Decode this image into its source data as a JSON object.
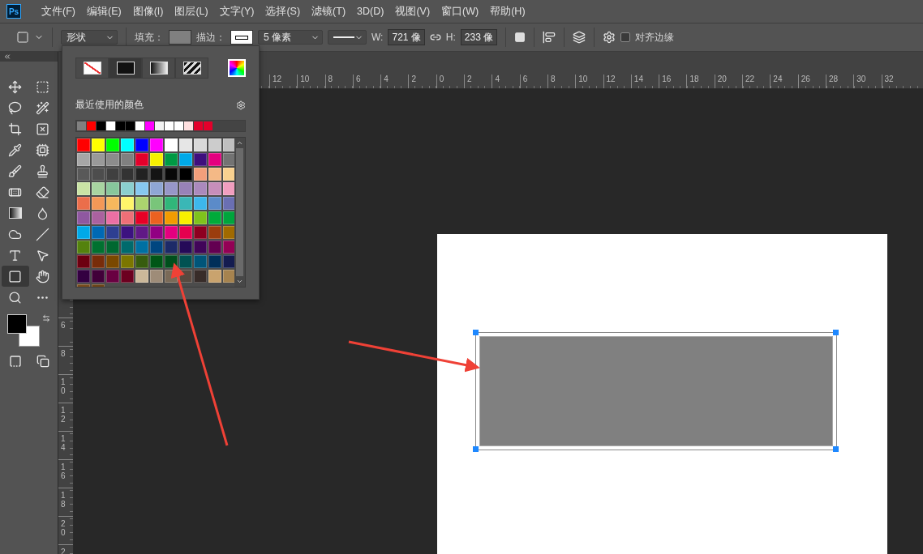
{
  "app": {
    "logo": "Ps"
  },
  "menu": [
    "文件(F)",
    "编辑(E)",
    "图像(I)",
    "图层(L)",
    "文字(Y)",
    "选择(S)",
    "滤镜(T)",
    "3D(D)",
    "视图(V)",
    "窗口(W)",
    "帮助(H)"
  ],
  "options_bar": {
    "mode": "形状",
    "fill": {
      "label": "填充：",
      "color": "#808080"
    },
    "stroke": {
      "label": "描边：",
      "color": "#ffffff"
    },
    "stroke_width": "5 像素",
    "width": {
      "label": "W:",
      "value": "721 像"
    },
    "height": {
      "label": "H:",
      "value": "233 像"
    },
    "snap": {
      "label": "对齐边缘",
      "checked": false
    }
  },
  "tools": [
    {
      "selected": false
    },
    {
      "selected": false
    },
    {
      "selected": false
    },
    {
      "selected": false
    },
    {
      "selected": false
    },
    {
      "selected": false
    },
    {
      "selected": false
    },
    {
      "selected": false
    },
    {
      "selected": false
    },
    {
      "selected": false
    },
    {
      "selected": false
    },
    {
      "selected": false
    },
    {
      "selected": false
    },
    {
      "selected": false
    },
    {
      "selected": false
    },
    {
      "selected": false
    },
    {
      "selected": false
    },
    {
      "selected": false
    },
    {
      "selected": true
    },
    {
      "selected": false
    },
    {
      "selected": false
    },
    {
      "selected": false
    }
  ],
  "colors": {
    "foreground": {
      "color": "#000000"
    },
    "background": {
      "color": "#ffffff"
    }
  },
  "swatch_panel": {
    "fill_types": [
      {
        "kind": "none",
        "selected": false
      },
      {
        "kind": "solid",
        "selected": true
      },
      {
        "kind": "gradient",
        "selected": false
      },
      {
        "kind": "pattern",
        "selected": false
      }
    ],
    "recent_title": "最近使用的颜色",
    "recent": [
      {
        "color": "#808080"
      },
      {
        "color": "#ff0000"
      },
      {
        "color": "#000000"
      },
      {
        "color": "#ffffff"
      },
      {
        "color": "#000000"
      },
      {
        "color": "#000000"
      },
      {
        "color": "#ffffff"
      },
      {
        "color": "#ff00ff"
      },
      {
        "color": "#f2f2f2"
      },
      {
        "color": "#ffffff"
      },
      {
        "color": "#ffffff"
      },
      {
        "color": "#ffe0e0"
      },
      {
        "color": "#e4002b"
      },
      {
        "color": "#e4002b"
      }
    ],
    "rows": [
      {
        "swatches": [
          {
            "color": "#ff0000"
          },
          {
            "color": "#ffff00"
          },
          {
            "color": "#00ff00"
          },
          {
            "color": "#00ffff"
          },
          {
            "color": "#0000ff"
          },
          {
            "color": "#ff00ff"
          },
          {
            "color": "#ffffff"
          },
          {
            "color": "#e6e6e6"
          },
          {
            "color": "#d9d9d9"
          },
          {
            "color": "#cccccc"
          },
          {
            "color": "#bfbfbf"
          }
        ]
      },
      {
        "swatches": [
          {
            "color": "#a6a6a6"
          },
          {
            "color": "#999999"
          },
          {
            "color": "#8c8c8c"
          },
          {
            "color": "#808080"
          },
          {
            "color": "#e4002b"
          },
          {
            "color": "#f7f000"
          },
          {
            "color": "#009a44"
          },
          {
            "color": "#00a9e8"
          },
          {
            "color": "#3e0f7d"
          },
          {
            "color": "#e4007f"
          },
          {
            "color": "#737373"
          }
        ]
      },
      {
        "swatches": [
          {
            "color": "#595959"
          },
          {
            "color": "#4d4d4d"
          },
          {
            "color": "#404040"
          },
          {
            "color": "#333333"
          },
          {
            "color": "#222222"
          },
          {
            "color": "#141414"
          },
          {
            "color": "#080808"
          },
          {
            "color": "#000000"
          },
          {
            "color": "#f29f7b"
          },
          {
            "color": "#f4b986"
          },
          {
            "color": "#f9d18f"
          }
        ]
      },
      {
        "swatches": [
          {
            "color": "#cae3a5"
          },
          {
            "color": "#a8d5a1"
          },
          {
            "color": "#87c79c"
          },
          {
            "color": "#8bcfcf"
          },
          {
            "color": "#87c8f0"
          },
          {
            "color": "#8fa6d4"
          },
          {
            "color": "#9796c8"
          },
          {
            "color": "#9882b8"
          },
          {
            "color": "#ab89bc"
          },
          {
            "color": "#c78eba"
          },
          {
            "color": "#f19ebf"
          }
        ]
      },
      {
        "swatches": [
          {
            "color": "#eb6e4b"
          },
          {
            "color": "#f39857"
          },
          {
            "color": "#f6b85d"
          },
          {
            "color": "#fff56a"
          },
          {
            "color": "#acd46e"
          },
          {
            "color": "#79c57a"
          },
          {
            "color": "#30b67a"
          },
          {
            "color": "#3ab7b6"
          },
          {
            "color": "#3db7ec"
          },
          {
            "color": "#5b8bc9"
          },
          {
            "color": "#6a6fb3"
          }
        ]
      },
      {
        "swatches": [
          {
            "color": "#8f58a0"
          },
          {
            "color": "#aa619f"
          },
          {
            "color": "#eb6fa4"
          },
          {
            "color": "#ee6f77"
          },
          {
            "color": "#e60026"
          },
          {
            "color": "#eb6120"
          },
          {
            "color": "#f29b00"
          },
          {
            "color": "#f8f000"
          },
          {
            "color": "#7fc31c"
          },
          {
            "color": "#00ab3a"
          },
          {
            "color": "#00a53c"
          }
        ]
      },
      {
        "swatches": [
          {
            "color": "#00a9e8"
          },
          {
            "color": "#0069b4"
          },
          {
            "color": "#2e3f91"
          },
          {
            "color": "#3c1280"
          },
          {
            "color": "#601986"
          },
          {
            "color": "#920083"
          },
          {
            "color": "#e4007f"
          },
          {
            "color": "#e5004f"
          },
          {
            "color": "#8e0020"
          },
          {
            "color": "#9b3d0e"
          },
          {
            "color": "#a06a00"
          }
        ]
      },
      {
        "swatches": [
          {
            "color": "#54820e"
          },
          {
            "color": "#007130"
          },
          {
            "color": "#006830"
          },
          {
            "color": "#006a6c"
          },
          {
            "color": "#0070a2"
          },
          {
            "color": "#004680"
          },
          {
            "color": "#1d2a68"
          },
          {
            "color": "#250a58"
          },
          {
            "color": "#410559"
          },
          {
            "color": "#630051"
          },
          {
            "color": "#930055"
          }
        ]
      },
      {
        "swatches": [
          {
            "color": "#6d0010"
          },
          {
            "color": "#782c0a"
          },
          {
            "color": "#7a4800"
          },
          {
            "color": "#7b7600"
          },
          {
            "color": "#375c0e"
          },
          {
            "color": "#005616"
          },
          {
            "color": "#004f1c"
          },
          {
            "color": "#005252"
          },
          {
            "color": "#005579"
          },
          {
            "color": "#002f59"
          },
          {
            "color": "#141c50"
          }
        ]
      },
      {
        "swatches": [
          {
            "color": "#330041"
          },
          {
            "color": "#410039"
          },
          {
            "color": "#690041"
          },
          {
            "color": "#6c001f"
          },
          {
            "color": "#cbb89a"
          },
          {
            "color": "#9e8c78"
          },
          {
            "color": "#7a6a58"
          },
          {
            "color": "#574a40"
          },
          {
            "color": "#382c29"
          },
          {
            "color": "#c9a36e"
          },
          {
            "color": "#a6834f"
          }
        ]
      },
      {
        "swatches": [
          {
            "color": "#7a4c1c"
          },
          {
            "color": "#6e4518"
          }
        ]
      }
    ]
  },
  "horizontal_ruler": [
    "12",
    "10",
    "8",
    "6",
    "4",
    "2",
    "0",
    "2",
    "4",
    "6",
    "8",
    "10",
    "12",
    "14",
    "16",
    "18",
    "20",
    "22",
    "24",
    "26",
    "28",
    "30",
    "32"
  ],
  "vertical_ruler": [
    "6",
    "8",
    "10",
    "12",
    "14",
    "16",
    "18",
    "20",
    "2"
  ]
}
